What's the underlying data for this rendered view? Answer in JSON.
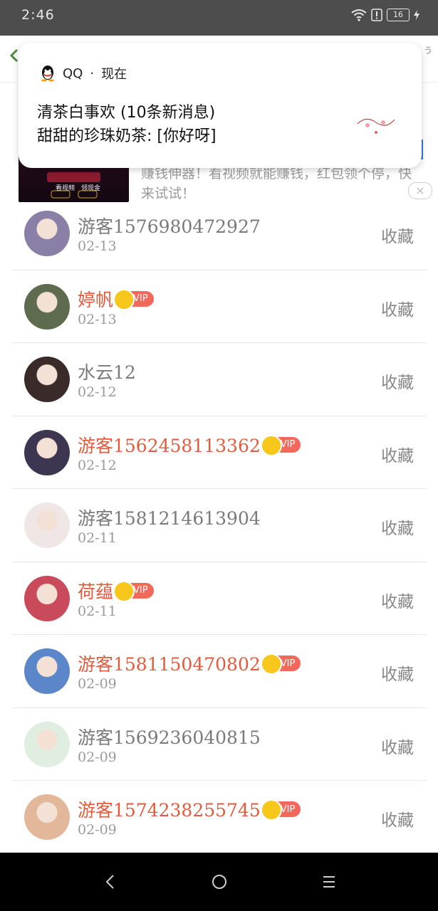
{
  "status_bar": {
    "time": "2:46",
    "battery": "16"
  },
  "app_bar": {
    "right_text": "う",
    "back_icon": "chevron-left-icon"
  },
  "notification": {
    "app_name": "QQ",
    "separator": "·",
    "when": "现在",
    "line1": "清茶白事欢 (10条新消息)",
    "line2": "甜甜的珍珠奶茶: [你好呀]"
  },
  "ad": {
    "text": "赚钱伸器！看视频就能赚钱，红包领个停，快来试试！",
    "close": "×",
    "image_buttons": [
      "看视频",
      "领现金"
    ]
  },
  "list": {
    "action_label": "收藏",
    "vip_label": "VIP",
    "items": [
      {
        "name": "游客1576980472927",
        "date": "02-13",
        "vip": false,
        "avatar_color": "#8a7fa6"
      },
      {
        "name": "婷帆",
        "date": "02-13",
        "vip": true,
        "avatar_color": "#5e6b4e"
      },
      {
        "name": "水云12",
        "date": "02-12",
        "vip": false,
        "avatar_color": "#3a2a2a"
      },
      {
        "name": "游客1562458113362",
        "date": "02-12",
        "vip": true,
        "avatar_color": "#3c3650"
      },
      {
        "name": "游客1581214613904",
        "date": "02-11",
        "vip": false,
        "avatar_color": "#f0e6e6"
      },
      {
        "name": "荷蕴",
        "date": "02-11",
        "vip": true,
        "avatar_color": "#c94a5a"
      },
      {
        "name": "游客1581150470802",
        "date": "02-09",
        "vip": true,
        "avatar_color": "#5b86c9"
      },
      {
        "name": "游客1569236040815",
        "date": "02-09",
        "vip": false,
        "avatar_color": "#dfeee0"
      },
      {
        "name": "游客1574238255745",
        "date": "02-09",
        "vip": true,
        "avatar_color": "#e3b89a"
      }
    ]
  },
  "colors": {
    "vip_name": "#e35a3c",
    "normal_name": "#7a7a7a",
    "vip_badge": "#f2685a",
    "crown": "#f7c71c"
  }
}
